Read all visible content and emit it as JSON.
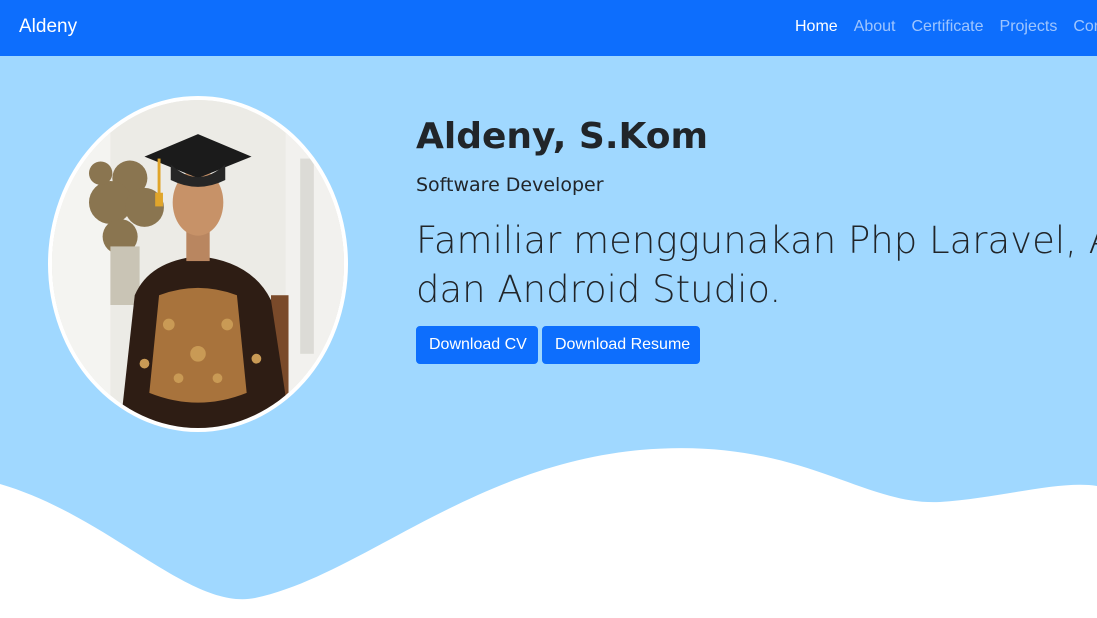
{
  "navbar": {
    "brand": "Aldeny",
    "links": [
      "Home",
      "About",
      "Certificate",
      "Projects",
      "Contact"
    ],
    "active_index": 0
  },
  "hero": {
    "name": "Aldeny, S.Kom",
    "role": "Software Developer",
    "lead_line1": "Familiar menggunakan Php Laravel, Ajax,",
    "lead_line2": "dan Android Studio.",
    "buttons": {
      "cv": "Download CV",
      "resume": "Download Resume"
    }
  },
  "colors": {
    "navbar": "#0d6efd",
    "hero_bg": "#a0d8ff",
    "button": "#0d6efd",
    "text": "#212529"
  }
}
